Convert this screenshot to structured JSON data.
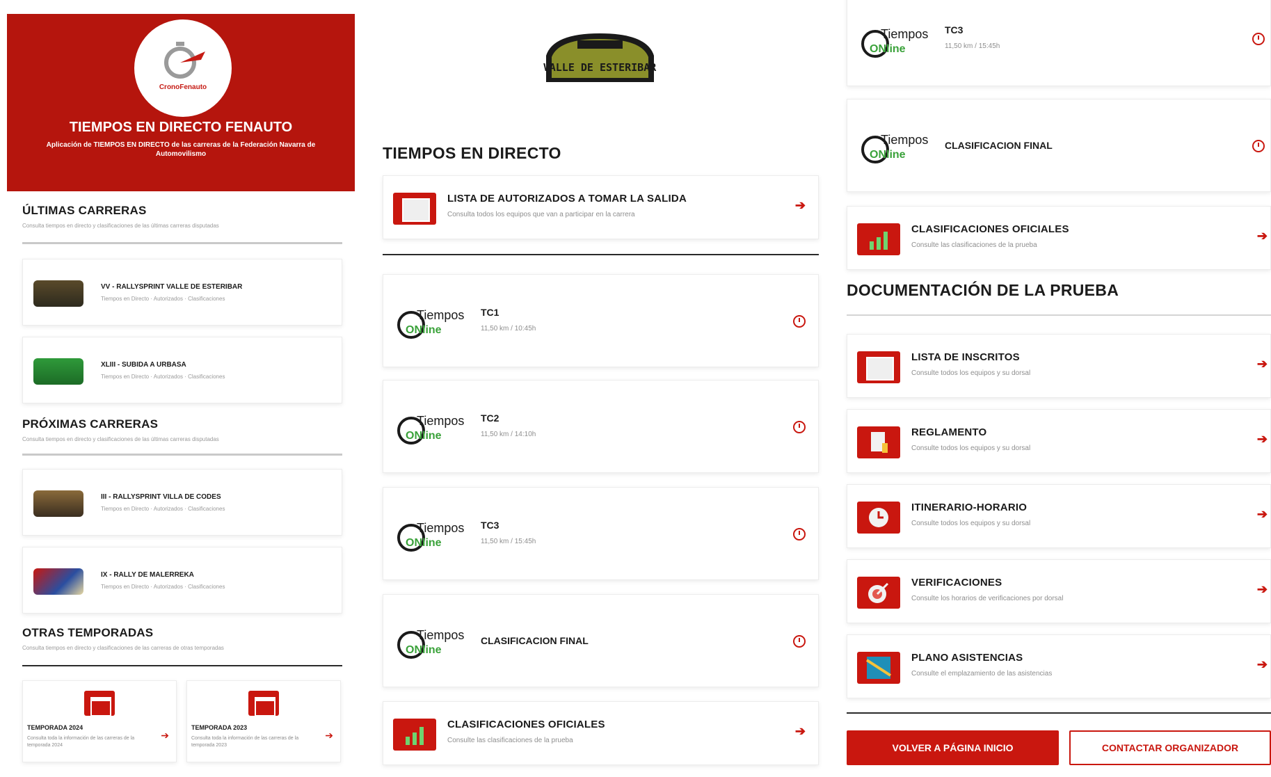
{
  "fenauto": {
    "logo_text": "CronoFenauto",
    "title": "TIEMPOS EN DIRECTO FENAUTO",
    "subtitle": "Aplicación de TIEMPOS EN DIRECTO de las carreras de la Federación Navarra de Automovilismo"
  },
  "ultimas": {
    "title": "ÚLTIMAS CARRERAS",
    "subtitle": "Consulta tiempos en directo y clasificaciones de las últimas carreras disputadas",
    "items": [
      {
        "name": "VV - RALLYSPRINT VALLE DE ESTERIBAR",
        "sub": "Tiempos en Directo · Autorizados · Clasificaciones"
      },
      {
        "name": "XLIII - SUBIDA A URBASA",
        "sub": "Tiempos en Directo · Autorizados · Clasificaciones"
      }
    ]
  },
  "proximas": {
    "title": "PRÓXIMAS CARRERAS",
    "subtitle": "Consulta tiempos en directo y clasificaciones de las últimas carreras disputadas",
    "items": [
      {
        "name": "III - RALLYSPRINT VILLA DE CODES",
        "sub": "Tiempos en Directo · Autorizados · Clasificaciones"
      },
      {
        "name": "IX - RALLY DE MALERREKA",
        "sub": "Tiempos en Directo · Autorizados · Clasificaciones"
      }
    ]
  },
  "otras": {
    "title": "OTRAS TEMPORADAS",
    "subtitle": "Consulta tiempos en directo y clasificaciones de las carreras de otras temporadas",
    "items": [
      {
        "name": "TEMPORADA 2024",
        "sub": "Consulta toda la información de las carreras de la temporada 2024"
      },
      {
        "name": "TEMPORADA 2023",
        "sub": "Consulta toda la información de las carreras de la temporada 2023"
      }
    ]
  },
  "event": {
    "logo_text": "VALLE DE ESTERIBAR",
    "live_title": "TIEMPOS EN DIRECTO",
    "autorizados": {
      "title": "LISTA DE AUTORIZADOS A TOMAR LA SALIDA",
      "sub": "Consulta todos los equipos que van a participar en la carrera"
    },
    "stages": [
      {
        "label": "TC1",
        "dist": "11,50 km / 10:45h"
      },
      {
        "label": "TC2",
        "dist": "11,50 km / 14:10h"
      },
      {
        "label": "TC3",
        "dist": "11,50 km / 15:45h"
      }
    ],
    "final": "CLASIFICACION FINAL",
    "oficiales": {
      "title": "CLASIFICACIONES OFICIALES",
      "sub": "Consulte las clasificaciones de la prueba"
    },
    "tiempos_online": {
      "line1": "Tiempos",
      "line2": "ONline"
    }
  },
  "docs": {
    "title": "DOCUMENTACIÓN DE LA PRUEBA",
    "items": [
      {
        "title": "LISTA DE INSCRITOS",
        "sub": "Consulte todos los equipos y su dorsal"
      },
      {
        "title": "REGLAMENTO",
        "sub": "Consulte todos los equipos y su dorsal"
      },
      {
        "title": "ITINERARIO-HORARIO",
        "sub": "Consulte todos los equipos y su dorsal"
      },
      {
        "title": "VERIFICACIONES",
        "sub": "Consulte los horarios de verificaciones por dorsal"
      },
      {
        "title": "PLANO ASISTENCIAS",
        "sub": "Consulte el emplazamiento de las asistencias"
      }
    ]
  },
  "buttons": {
    "home": "VOLVER A PÁGINA INICIO",
    "contact": "CONTACTAR ORGANIZADOR"
  },
  "colors": {
    "brand_red": "#c9170f",
    "hero_red": "#b5150d"
  }
}
